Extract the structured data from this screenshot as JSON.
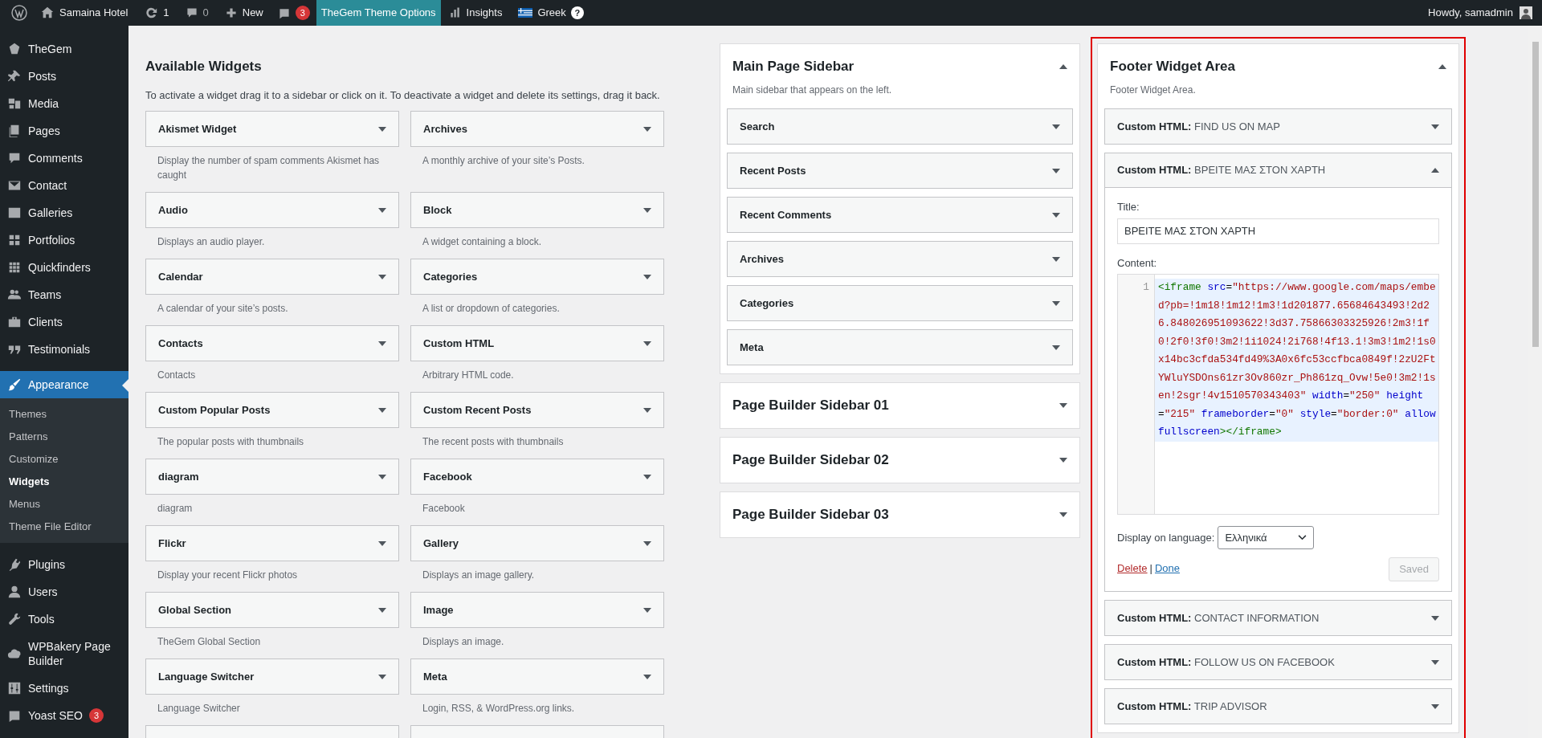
{
  "admin_bar": {
    "site": "Samaina Hotel",
    "updates": "1",
    "comments": "0",
    "new": "New",
    "yoast_badge": "3",
    "theme_options": {
      "label": "TheGem Theme Options",
      "selected": true
    },
    "insights": "Insights",
    "language": {
      "label": "Greek",
      "help": "?"
    },
    "greeting": "Howdy, samadmin"
  },
  "sidebar": {
    "items": [
      {
        "label": "TheGem",
        "selected": false
      },
      {
        "label": "Posts",
        "selected": false
      },
      {
        "label": "Media",
        "selected": false
      },
      {
        "label": "Pages",
        "selected": false
      },
      {
        "label": "Comments",
        "selected": false
      },
      {
        "label": "Contact",
        "selected": false
      },
      {
        "label": "Galleries",
        "selected": false
      },
      {
        "label": "Portfolios",
        "selected": false
      },
      {
        "label": "Quickfinders",
        "selected": false
      },
      {
        "label": "Teams",
        "selected": false
      },
      {
        "label": "Clients",
        "selected": false
      },
      {
        "label": "Testimonials",
        "selected": false
      },
      {
        "label": "Appearance",
        "selected": true,
        "children": [
          {
            "label": "Themes",
            "selected": false
          },
          {
            "label": "Patterns",
            "selected": false
          },
          {
            "label": "Customize",
            "selected": false
          },
          {
            "label": "Widgets",
            "selected": true
          },
          {
            "label": "Menus",
            "selected": false
          },
          {
            "label": "Theme File Editor",
            "selected": false
          }
        ]
      },
      {
        "label": "Plugins",
        "selected": false
      },
      {
        "label": "Users",
        "selected": false
      },
      {
        "label": "Tools",
        "selected": false
      },
      {
        "label": "WPBakery Page Builder",
        "selected": false
      },
      {
        "label": "Settings",
        "selected": false
      },
      {
        "label": "Yoast SEO",
        "selected": false,
        "badge": "3"
      }
    ]
  },
  "available_widgets": {
    "title": "Available Widgets",
    "description": "To activate a widget drag it to a sidebar or click on it. To deactivate a widget and delete its settings, drag it back.",
    "widgets": [
      {
        "name": "Akismet Widget",
        "description": "Display the number of spam comments Akismet has caught"
      },
      {
        "name": "Archives",
        "description": "A monthly archive of your site’s Posts."
      },
      {
        "name": "Audio",
        "description": "Displays an audio player."
      },
      {
        "name": "Block",
        "description": "A widget containing a block."
      },
      {
        "name": "Calendar",
        "description": "A calendar of your site’s posts."
      },
      {
        "name": "Categories",
        "description": "A list or dropdown of categories."
      },
      {
        "name": "Contacts",
        "description": "Contacts"
      },
      {
        "name": "Custom HTML",
        "description": "Arbitrary HTML code."
      },
      {
        "name": "Custom Popular Posts",
        "description": "The popular posts with thumbnails"
      },
      {
        "name": "Custom Recent Posts",
        "description": "The recent posts with thumbnails"
      },
      {
        "name": "diagram",
        "description": "diagram"
      },
      {
        "name": "Facebook",
        "description": "Facebook"
      },
      {
        "name": "Flickr",
        "description": "Display your recent Flickr photos"
      },
      {
        "name": "Gallery",
        "description": "Displays an image gallery."
      },
      {
        "name": "Global Section",
        "description": "TheGem Global Section"
      },
      {
        "name": "Image",
        "description": "Displays an image."
      },
      {
        "name": "Language Switcher",
        "description": "Language Switcher"
      },
      {
        "name": "Meta",
        "description": "Login, RSS, & WordPress.org links."
      }
    ]
  },
  "sidebars": [
    {
      "title": "Main Page Sidebar",
      "expanded": true,
      "description": "Main sidebar that appears on the left.",
      "widgets": [
        {
          "title": "Search"
        },
        {
          "title": "Recent Posts"
        },
        {
          "title": "Recent Comments"
        },
        {
          "title": "Archives"
        },
        {
          "title": "Categories"
        },
        {
          "title": "Meta"
        }
      ]
    },
    {
      "title": "Page Builder Sidebar 01",
      "expanded": false
    },
    {
      "title": "Page Builder Sidebar 02",
      "expanded": false
    },
    {
      "title": "Page Builder Sidebar 03",
      "expanded": false
    }
  ],
  "footer_area": {
    "title": "Footer Widget Area",
    "expanded": true,
    "description": "Footer Widget Area.",
    "widgets": [
      {
        "prefix": "Custom HTML:",
        "title": "FIND US ON MAP",
        "expanded": false
      },
      {
        "prefix": "Custom HTML:",
        "title": "ΒΡΕΙΤΕ ΜΑΣ ΣΤΟΝ ΧΑΡΤΗ",
        "expanded": true,
        "form": {
          "title_label": "Title:",
          "title_value": "ΒΡΕΙΤΕ ΜΑΣ ΣΤΟΝ ΧΑΡΤΗ",
          "content_label": "Content:",
          "line_number": "1",
          "code": [
            {
              "kind": "tag",
              "text": "<iframe"
            },
            {
              "kind": "attr",
              "text": " src"
            },
            {
              "kind": "plain",
              "text": "="
            },
            {
              "kind": "string",
              "text": "\"https://www.google.com/maps/embed?pb=!1m18!1m12!1m3!1d201877.65684643493!2d26.848026951093622!3d37.75866303325926!2m3!1f0!2f0!3f0!3m2!1i1024!2i768!4f13.1!3m3!1m2!1s0x14bc3cfda534fd49%3A0x6fc53ccfbca0849f!2zU2FtYWluYSDOns61zr3Ov860zr_Ph861zq_Ovw!5e0!3m2!1sen!2sgr!4v1510570343403\""
            },
            {
              "kind": "attr",
              "text": " width"
            },
            {
              "kind": "plain",
              "text": "="
            },
            {
              "kind": "string",
              "text": "\"250\""
            },
            {
              "kind": "attr",
              "text": " height"
            },
            {
              "kind": "plain",
              "text": "="
            },
            {
              "kind": "string",
              "text": "\"215\""
            },
            {
              "kind": "attr",
              "text": " frameborder"
            },
            {
              "kind": "plain",
              "text": "="
            },
            {
              "kind": "string",
              "text": "\"0\""
            },
            {
              "kind": "attr",
              "text": " style"
            },
            {
              "kind": "plain",
              "text": "="
            },
            {
              "kind": "string",
              "text": "\"border:0\""
            },
            {
              "kind": "attr",
              "text": " allowfullscreen"
            },
            {
              "kind": "tag",
              "text": "></iframe>"
            }
          ],
          "language_label": "Display on language:",
          "language_value": "Ελληνικά",
          "delete": "Delete",
          "separator": "|",
          "done": "Done",
          "save": "Saved",
          "save_disabled": true
        }
      },
      {
        "prefix": "Custom HTML:",
        "title": "CONTACT INFORMATION",
        "expanded": false
      },
      {
        "prefix": "Custom HTML:",
        "title": "FOLLOW US ON FACEBOOK",
        "expanded": false
      },
      {
        "prefix": "Custom HTML:",
        "title": "TRIP ADVISOR",
        "expanded": false
      }
    ]
  }
}
